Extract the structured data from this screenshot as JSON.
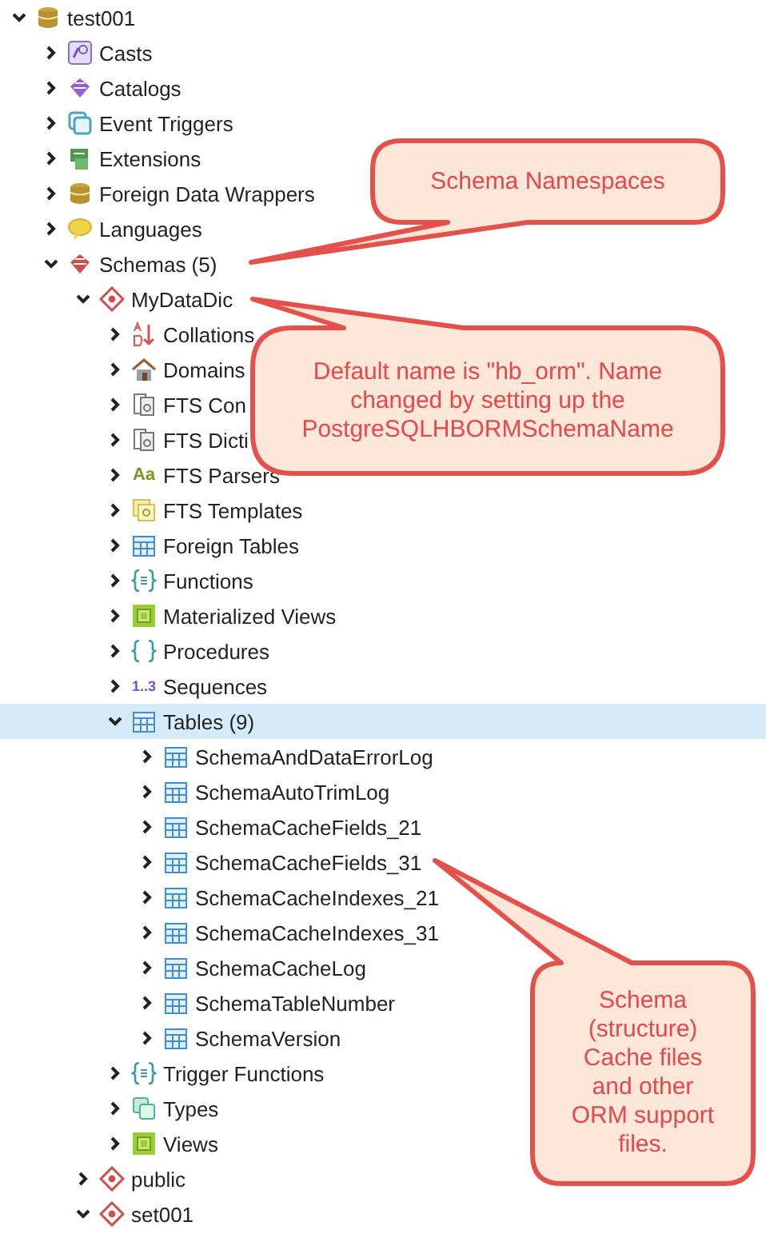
{
  "tree": [
    {
      "label": "test001",
      "kind": "database",
      "expanded": true,
      "selected": false,
      "children": [
        {
          "label": "Casts",
          "kind": "casts",
          "expanded": false,
          "selected": false
        },
        {
          "label": "Catalogs",
          "kind": "catalogs",
          "expanded": false,
          "selected": false
        },
        {
          "label": "Event Triggers",
          "kind": "event-triggers",
          "expanded": false,
          "selected": false
        },
        {
          "label": "Extensions",
          "kind": "extensions",
          "expanded": false,
          "selected": false
        },
        {
          "label": "Foreign Data Wrappers",
          "kind": "fdw",
          "expanded": false,
          "selected": false
        },
        {
          "label": "Languages",
          "kind": "languages",
          "expanded": false,
          "selected": false
        },
        {
          "label": "Schemas (5)",
          "kind": "schemas",
          "expanded": true,
          "selected": false,
          "children": [
            {
              "label": "MyDataDic",
              "kind": "schema",
              "expanded": true,
              "selected": false,
              "children": [
                {
                  "label": "Collations",
                  "kind": "collations",
                  "expanded": false,
                  "selected": false
                },
                {
                  "label": "Domains",
                  "kind": "domains",
                  "expanded": false,
                  "selected": false
                },
                {
                  "label": "FTS Con",
                  "kind": "fts-config",
                  "expanded": false,
                  "selected": false
                },
                {
                  "label": "FTS Dicti",
                  "kind": "fts-dict",
                  "expanded": false,
                  "selected": false
                },
                {
                  "label": "FTS Parsers",
                  "kind": "fts-parser",
                  "icon_text": "Aa",
                  "expanded": false,
                  "selected": false
                },
                {
                  "label": "FTS Templates",
                  "kind": "fts-template",
                  "expanded": false,
                  "selected": false
                },
                {
                  "label": "Foreign Tables",
                  "kind": "foreign-table",
                  "expanded": false,
                  "selected": false
                },
                {
                  "label": "Functions",
                  "kind": "function",
                  "expanded": false,
                  "selected": false
                },
                {
                  "label": "Materialized Views",
                  "kind": "matview",
                  "expanded": false,
                  "selected": false
                },
                {
                  "label": "Procedures",
                  "kind": "procedure",
                  "expanded": false,
                  "selected": false
                },
                {
                  "label": "Sequences",
                  "kind": "sequence",
                  "icon_text": "1..3",
                  "expanded": false,
                  "selected": false
                },
                {
                  "label": "Tables (9)",
                  "kind": "tables",
                  "expanded": true,
                  "selected": true,
                  "children": [
                    {
                      "label": "SchemaAndDataErrorLog",
                      "kind": "table",
                      "expanded": false,
                      "selected": false
                    },
                    {
                      "label": "SchemaAutoTrimLog",
                      "kind": "table",
                      "expanded": false,
                      "selected": false
                    },
                    {
                      "label": "SchemaCacheFields_21",
                      "kind": "table",
                      "expanded": false,
                      "selected": false
                    },
                    {
                      "label": "SchemaCacheFields_31",
                      "kind": "table",
                      "expanded": false,
                      "selected": false
                    },
                    {
                      "label": "SchemaCacheIndexes_21",
                      "kind": "table",
                      "expanded": false,
                      "selected": false
                    },
                    {
                      "label": "SchemaCacheIndexes_31",
                      "kind": "table",
                      "expanded": false,
                      "selected": false
                    },
                    {
                      "label": "SchemaCacheLog",
                      "kind": "table",
                      "expanded": false,
                      "selected": false
                    },
                    {
                      "label": "SchemaTableNumber",
                      "kind": "table",
                      "expanded": false,
                      "selected": false
                    },
                    {
                      "label": "SchemaVersion",
                      "kind": "table",
                      "expanded": false,
                      "selected": false
                    }
                  ]
                },
                {
                  "label": "Trigger Functions",
                  "kind": "trigger-function",
                  "expanded": false,
                  "selected": false
                },
                {
                  "label": "Types",
                  "kind": "types",
                  "expanded": false,
                  "selected": false
                },
                {
                  "label": "Views",
                  "kind": "views",
                  "expanded": false,
                  "selected": false
                }
              ]
            },
            {
              "label": "public",
              "kind": "schema",
              "expanded": false,
              "selected": false
            },
            {
              "label": "set001",
              "kind": "schema",
              "expanded": true,
              "selected": false
            }
          ]
        }
      ]
    }
  ],
  "callouts": [
    {
      "text": "Schema Namespaces"
    },
    {
      "text": "Default name is \"hb_orm\". Name changed by setting up the PostgreSQLHBORMSchemaName"
    },
    {
      "text": "Schema (structure) Cache files and other ORM support files."
    }
  ]
}
